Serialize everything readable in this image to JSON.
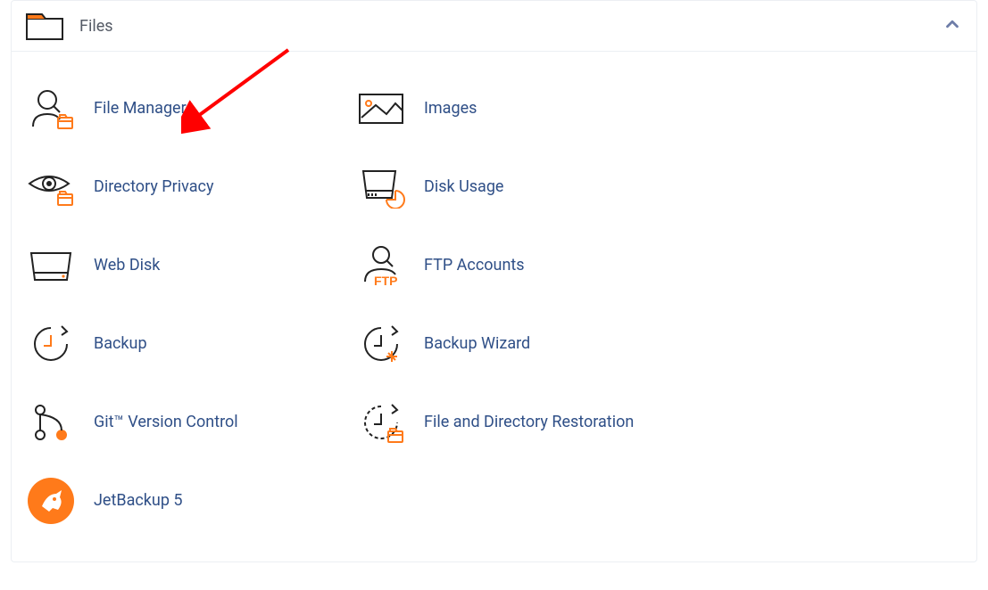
{
  "panel": {
    "title": "Files",
    "collapse_direction": "up"
  },
  "items": {
    "col1": [
      {
        "id": "file-manager",
        "label": "File Manager"
      },
      {
        "id": "directory-privacy",
        "label": "Directory Privacy"
      },
      {
        "id": "web-disk",
        "label": "Web Disk"
      },
      {
        "id": "backup",
        "label": "Backup"
      },
      {
        "id": "git-version-control",
        "label": "Git™ Version Control"
      },
      {
        "id": "jetbackup5",
        "label": "JetBackup 5"
      }
    ],
    "col2": [
      {
        "id": "images",
        "label": "Images"
      },
      {
        "id": "disk-usage",
        "label": "Disk Usage"
      },
      {
        "id": "ftp-accounts",
        "label": "FTP Accounts"
      },
      {
        "id": "backup-wizard",
        "label": "Backup Wizard"
      },
      {
        "id": "file-directory-restoration",
        "label": "File and Directory Restoration"
      }
    ]
  },
  "annotation": {
    "type": "arrow",
    "target_item": "file-manager",
    "color": "#ff0000"
  }
}
